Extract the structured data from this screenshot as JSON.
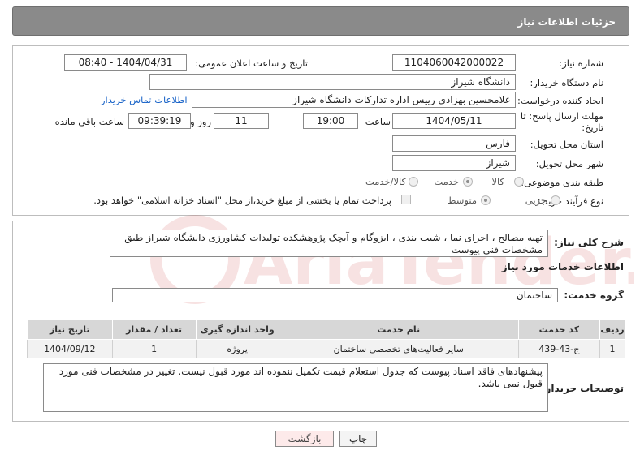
{
  "header": {
    "title": "جزئیات اطلاعات نیاز"
  },
  "form": {
    "need_number_label": "شماره نیاز:",
    "need_number": "1104060042000022",
    "announce_label": "تاریخ و ساعت اعلان عمومی:",
    "announce_value": "1404/04/31 - 08:40",
    "buyer_org_label": "نام دستگاه خریدار:",
    "buyer_org": "دانشگاه شیراز",
    "creator_label": "ایجاد کننده درخواست:",
    "creator": "غلامحسین بهزادی رییس اداره تدارکات دانشگاه شیراز",
    "contact_link": "اطلاعات تماس خریدار",
    "deadline_label_1": "مهلت ارسال پاسخ: تا",
    "deadline_label_2": "تاریخ:",
    "deadline_date": "1404/05/11",
    "time_label": "ساعت",
    "deadline_time": "19:00",
    "days_value": "11",
    "days_label": "روز و",
    "remaining_time": "09:39:19",
    "remaining_label": "ساعت باقی مانده",
    "province_label": "استان محل تحویل:",
    "province": "فارس",
    "city_label": "شهر محل تحویل:",
    "city": "شیراز",
    "category_label": "طبقه بندی موضوعی:",
    "category_options": [
      "کالا",
      "خدمت",
      "کالا/خدمت"
    ],
    "process_label": "نوع فرآیند خرید :",
    "process_options": [
      "جزیی",
      "متوسط"
    ],
    "payment_note": "پرداخت تمام یا بخشی از مبلغ خرید،از محل \"اسناد خزانه اسلامی\" خواهد بود."
  },
  "summary": {
    "label": "شرح کلی نیاز:",
    "text": "تهیه مصالح ، اجرای نما ، شیب بندی ، ایزوگام و آبچک پژوهشکده تولیدات کشاورزی دانشگاه شیراز طبق مشخصات فنی پیوست"
  },
  "services": {
    "section_title": "اطلاعات خدمات مورد نیاز",
    "group_label": "گروه خدمت:",
    "group_value": "ساختمان",
    "columns": [
      "ردیف",
      "کد خدمت",
      "نام خدمت",
      "واحد اندازه گیری",
      "تعداد / مقدار",
      "تاریخ نیاز"
    ],
    "rows": [
      [
        "1",
        "ج-43-439",
        "سایر فعالیت‌های تخصصی ساختمان",
        "پروژه",
        "1",
        "1404/09/12"
      ]
    ]
  },
  "notes": {
    "label": "توضیحات خریدار:",
    "text": "پیشنهادهای فاقد اسناد پیوست که جدول استعلام قیمت تکمیل ننموده اند مورد قبول نیست. تغییر در مشخصات فنی مورد قبول نمی باشد."
  },
  "buttons": {
    "print": "چاپ",
    "back": "بازگشت"
  },
  "watermark": {
    "brand": "AriaTender.neT"
  }
}
